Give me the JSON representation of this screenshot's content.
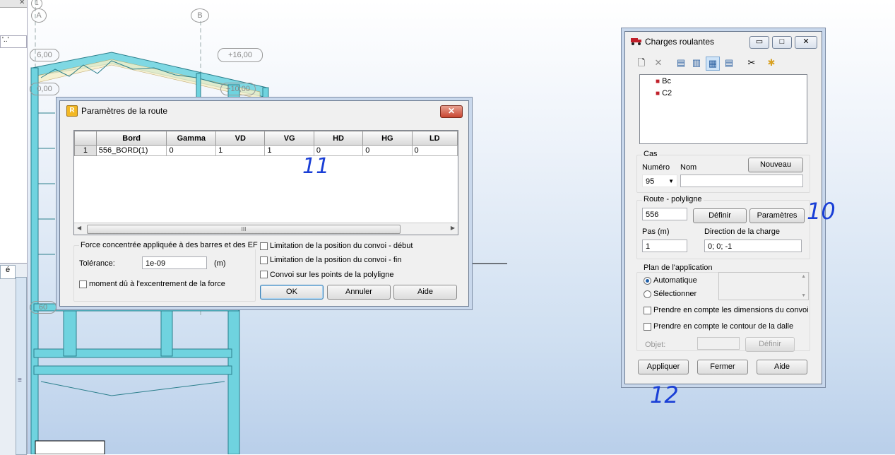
{
  "background": {
    "grid_axes": [
      "1",
      "A",
      "B"
    ],
    "levels": [
      "6,00",
      "+16,00",
      "0,00",
      "+10,00",
      "60"
    ],
    "left_panel_text": [
      "'..'",
      "é"
    ],
    "scroll_mark": "≡"
  },
  "route_dialog": {
    "title": "Paramètres de la route",
    "columns": [
      "Bord",
      "Gamma",
      "VD",
      "VG",
      "HD",
      "HG",
      "LD"
    ],
    "rows": [
      {
        "num": "1",
        "cells": [
          "556_BORD(1)",
          "0",
          "1",
          "1",
          "0",
          "0",
          "0"
        ]
      }
    ],
    "scroll_thumb": "III",
    "force_group_label": "Force concentrée appliquée à des barres et des EF",
    "tolerance_label": "Tolérance:",
    "tolerance_value": "1e-09",
    "tolerance_unit": "(m)",
    "moment_label": "moment dû à l'excentrement de la force",
    "limit_start_label": "Limitation de la position du convoi - début",
    "limit_end_label": "Limitation de la position du convoi - fin",
    "convoy_points_label": "Convoi sur les points de la polyligne",
    "ok_label": "OK",
    "cancel_label": "Annuler",
    "help_label": "Aide",
    "close_glyph": "✕"
  },
  "charges_window": {
    "title": "Charges roulantes",
    "tree_items": [
      "Bc",
      "C2"
    ],
    "cas_group": "Cas",
    "numero_label": "Numéro",
    "nom_label": "Nom",
    "numero_value": "95",
    "nom_value": "",
    "nouveau_label": "Nouveau",
    "route_group": "Route - polyligne",
    "route_value": "556",
    "definir_label": "Définir",
    "parametres_label": "Paramètres",
    "pas_label": "Pas (m)",
    "pas_value": "1",
    "direction_label": "Direction de la charge",
    "direction_value": "0; 0; -1",
    "plan_group": "Plan de l'application",
    "automatique_label": "Automatique",
    "selectionner_label": "Sélectionner",
    "dims_label": "Prendre en compte les dimensions du convoi",
    "contour_label": "Prendre en compte le contour de la dalle",
    "objet_label": "Objet:",
    "objet_definir_label": "Définir",
    "appliquer_label": "Appliquer",
    "fermer_label": "Fermer",
    "aide_label": "Aide",
    "minimize_glyph": "▭",
    "restore_glyph": "□",
    "close_glyph": "✕"
  },
  "annotations": {
    "dialog_number": "11",
    "parametres_number": "10",
    "window_number": "12"
  },
  "colors": {
    "structure": "#5fd0dc",
    "structure_dark": "#2b7f8c",
    "handwriting": "#1a3fd6",
    "selection_blue": "#cfe4f8"
  }
}
